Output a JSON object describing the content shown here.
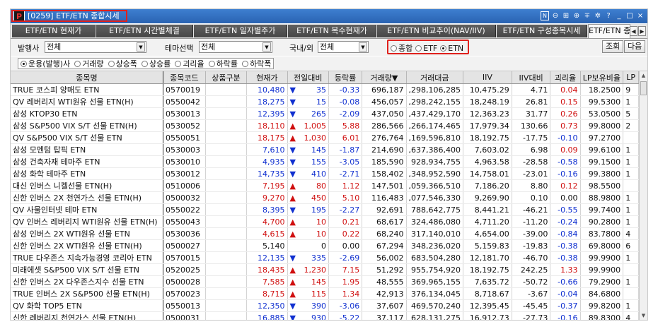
{
  "window": {
    "logo_text": "P",
    "title": "[0259] ETF/ETN 종합시세",
    "controls": [
      "N",
      "⊖",
      "⊞",
      "⊕",
      "∓",
      "✲",
      "?",
      "_",
      "□",
      "×"
    ]
  },
  "tabs": [
    {
      "label": "ETF/ETN 현재가"
    },
    {
      "label": "ETF/ETN 시간별체결"
    },
    {
      "label": "ETF/ETN 일자별주가"
    },
    {
      "label": "ETF/ETN 복수현재가"
    },
    {
      "label": "ETF/ETN 비교추이(NAV/IIV)"
    },
    {
      "label": "ETF/ETN 구성종목시세"
    },
    {
      "label": "ETF/ETN 종"
    }
  ],
  "filters": {
    "issuer_label": "발행사",
    "issuer_value": "전체",
    "theme_label": "테마선택",
    "theme_value": "전체",
    "region_label": "국내/외",
    "region_value": "전체",
    "type_options": [
      {
        "label": "종합",
        "selected": false
      },
      {
        "label": "ETF",
        "selected": false
      },
      {
        "label": "ETN",
        "selected": true
      }
    ],
    "search_button": "조회",
    "next_button": "다음",
    "sort_options": [
      {
        "label": "운용(발행)사",
        "selected": true
      },
      {
        "label": "거래량",
        "selected": false
      },
      {
        "label": "상승폭",
        "selected": false
      },
      {
        "label": "상승률",
        "selected": false
      },
      {
        "label": "괴리율",
        "selected": false
      },
      {
        "label": "하락률",
        "selected": false
      },
      {
        "label": "하락폭",
        "selected": false
      }
    ]
  },
  "table": {
    "columns": [
      "종목명",
      "종목코드",
      "상품구분",
      "현재가",
      "전일대비",
      "등락률",
      "거래량▼",
      "거래대금",
      "IIV",
      "IIV대비",
      "괴리율",
      "LP보유비율",
      "LP"
    ],
    "rows": [
      {
        "name": "TRUE 코스피 양매도 ETN",
        "code": "0570019",
        "type": "",
        "price": "10,480",
        "dir": "dn",
        "change": "35",
        "rate": "-0.33",
        "vol": "696,187",
        "amt": ",298,106,285",
        "iiv": "10,475.29",
        "iiv_diff": "4.71",
        "gap": "0.04",
        "lp": "18.2500",
        "lp2": "9"
      },
      {
        "name": "QV 레버리지 WTI원유 선물 ETN(H)",
        "code": "0550042",
        "type": "",
        "price": "18,275",
        "dir": "dn",
        "change": "15",
        "rate": "-0.08",
        "vol": "456,057",
        "amt": ",298,242,155",
        "iiv": "18,248.19",
        "iiv_diff": "26.81",
        "gap": "0.15",
        "lp": "99.5300",
        "lp2": "1"
      },
      {
        "name": "삼성 KTOP30 ETN",
        "code": "0530013",
        "type": "",
        "price": "12,395",
        "dir": "dn",
        "change": "265",
        "rate": "-2.09",
        "vol": "437,050",
        "amt": ",437,429,170",
        "iiv": "12,363.23",
        "iiv_diff": "31.77",
        "gap": "0.26",
        "lp": "53.0500",
        "lp2": "5"
      },
      {
        "name": "삼성 S&P500 VIX S/T 선물 ETN(H)",
        "code": "0530052",
        "type": "",
        "price": "18,110",
        "dir": "up",
        "change": "1,005",
        "rate": "5.88",
        "vol": "286,566",
        "amt": ",266,174,465",
        "iiv": "17,979.34",
        "iiv_diff": "130.66",
        "gap": "0.73",
        "lp": "99.8000",
        "lp2": "2"
      },
      {
        "name": "QV S&P500 VIX S/T 선물 ETN",
        "code": "0550051",
        "type": "",
        "price": "18,175",
        "dir": "up",
        "change": "1,030",
        "rate": "6.01",
        "vol": "276,764",
        "amt": ",169,596,810",
        "iiv": "18,192.75",
        "iiv_diff": "-17.75",
        "gap": "-0.10",
        "lp": "97.2700",
        "lp2": ""
      },
      {
        "name": "삼성 모멘텀 탑픽 ETN",
        "code": "0530003",
        "type": "",
        "price": "7,610",
        "dir": "dn",
        "change": "145",
        "rate": "-1.87",
        "vol": "214,690",
        "amt": ",637,386,400",
        "iiv": "7,603.02",
        "iiv_diff": "6.98",
        "gap": "0.09",
        "lp": "99.6100",
        "lp2": "1"
      },
      {
        "name": "삼성 건축자재 테마주 ETN",
        "code": "0530010",
        "type": "",
        "price": "4,935",
        "dir": "dn",
        "change": "155",
        "rate": "-3.05",
        "vol": "185,590",
        "amt": "928,934,755",
        "iiv": "4,963.58",
        "iiv_diff": "-28.58",
        "gap": "-0.58",
        "lp": "99.1500",
        "lp2": "1"
      },
      {
        "name": "삼성 화학 테마주 ETN",
        "code": "0530012",
        "type": "",
        "price": "14,735",
        "dir": "dn",
        "change": "410",
        "rate": "-2.71",
        "vol": "158,402",
        "amt": ",348,952,590",
        "iiv": "14,758.01",
        "iiv_diff": "-23.01",
        "gap": "-0.16",
        "lp": "99.3800",
        "lp2": "1"
      },
      {
        "name": "대신 인버스 니켈선물 ETN(H)",
        "code": "0510006",
        "type": "",
        "price": "7,195",
        "dir": "up",
        "change": "80",
        "rate": "1.12",
        "vol": "147,501",
        "amt": ",059,366,510",
        "iiv": "7,186.20",
        "iiv_diff": "8.80",
        "gap": "0.12",
        "lp": "98.5500",
        "lp2": ""
      },
      {
        "name": "신한 인버스 2X 천연가스 선물 ETN(H)",
        "code": "0500032",
        "type": "",
        "price": "9,270",
        "dir": "up",
        "change": "450",
        "rate": "5.10",
        "vol": "116,483",
        "amt": ",077,546,330",
        "iiv": "9,269.90",
        "iiv_diff": "0.10",
        "gap": "0.00",
        "lp": "88.9800",
        "lp2": "1"
      },
      {
        "name": "QV 사물인터넷 테마 ETN",
        "code": "0550022",
        "type": "",
        "price": "8,395",
        "dir": "dn",
        "change": "195",
        "rate": "-2.27",
        "vol": "92,691",
        "amt": "788,642,775",
        "iiv": "8,441.21",
        "iiv_diff": "-46.21",
        "gap": "-0.55",
        "lp": "99.7400",
        "lp2": "1"
      },
      {
        "name": "QV 인버스 레버리지 WTI원유 선물 ETN(H)",
        "code": "0550043",
        "type": "",
        "price": "4,700",
        "dir": "up",
        "change": "10",
        "rate": "0.21",
        "vol": "68,617",
        "amt": "324,486,080",
        "iiv": "4,711.20",
        "iiv_diff": "-11.20",
        "gap": "-0.24",
        "lp": "90.2800",
        "lp2": "1"
      },
      {
        "name": "삼성 인버스 2X WTI원유 선물 ETN",
        "code": "0530036",
        "type": "",
        "price": "4,615",
        "dir": "up",
        "change": "10",
        "rate": "0.22",
        "vol": "68,240",
        "amt": "317,140,010",
        "iiv": "4,654.00",
        "iiv_diff": "-39.00",
        "gap": "-0.84",
        "lp": "83.7800",
        "lp2": "4"
      },
      {
        "name": "신한 인버스 2X WTI원유 선물 ETN(H)",
        "code": "0500027",
        "type": "",
        "price": "5,140",
        "dir": "",
        "change": "0",
        "rate": "0.00",
        "vol": "67,294",
        "amt": "348,236,020",
        "iiv": "5,159.83",
        "iiv_diff": "-19.83",
        "gap": "-0.38",
        "lp": "69.8000",
        "lp2": "6"
      },
      {
        "name": "TRUE 다우존스 지속가능경영 코리아 ETN",
        "code": "0570015",
        "type": "",
        "price": "12,135",
        "dir": "dn",
        "change": "335",
        "rate": "-2.69",
        "vol": "56,002",
        "amt": "683,504,280",
        "iiv": "12,181.70",
        "iiv_diff": "-46.70",
        "gap": "-0.38",
        "lp": "99.9900",
        "lp2": "1"
      },
      {
        "name": "미래에셋 S&P500 VIX S/T 선물 ETN",
        "code": "0520025",
        "type": "",
        "price": "18,435",
        "dir": "up",
        "change": "1,230",
        "rate": "7.15",
        "vol": "51,292",
        "amt": "955,754,920",
        "iiv": "18,192.75",
        "iiv_diff": "242.25",
        "gap": "1.33",
        "lp": "99.9900",
        "lp2": ""
      },
      {
        "name": "신한 인버스 2X 다우존스지수 선물 ETN",
        "code": "0500028",
        "type": "",
        "price": "7,585",
        "dir": "up",
        "change": "145",
        "rate": "1.95",
        "vol": "48,555",
        "amt": "369,965,155",
        "iiv": "7,635.72",
        "iiv_diff": "-50.72",
        "gap": "-0.66",
        "lp": "79.2900",
        "lp2": "1"
      },
      {
        "name": "TRUE 인버스 2X S&P500 선물 ETN(H)",
        "code": "0570023",
        "type": "",
        "price": "8,715",
        "dir": "up",
        "change": "115",
        "rate": "1.34",
        "vol": "42,913",
        "amt": "376,134,045",
        "iiv": "8,718.67",
        "iiv_diff": "-3.67",
        "gap": "-0.04",
        "lp": "84.6800",
        "lp2": ""
      },
      {
        "name": "QV 화학 TOP5 ETN",
        "code": "0550013",
        "type": "",
        "price": "12,350",
        "dir": "dn",
        "change": "390",
        "rate": "-3.06",
        "vol": "37,607",
        "amt": "469,570,240",
        "iiv": "12,395.45",
        "iiv_diff": "-45.45",
        "gap": "-0.37",
        "lp": "99.8200",
        "lp2": "1"
      },
      {
        "name": "신한 레버리지 천연가스 선물 ETN(H)",
        "code": "0500031",
        "type": "",
        "price": "16,885",
        "dir": "dn",
        "change": "930",
        "rate": "-5.22",
        "vol": "37,117",
        "amt": "628,131,275",
        "iiv": "16,912.73",
        "iiv_diff": "-27.73",
        "gap": "-0.16",
        "lp": "89.8300",
        "lp2": "4"
      }
    ]
  },
  "colors": {
    "up": "#d01010",
    "down": "#1030d0",
    "highlight": "#e0201c",
    "titlebar": "#2a63b2"
  }
}
